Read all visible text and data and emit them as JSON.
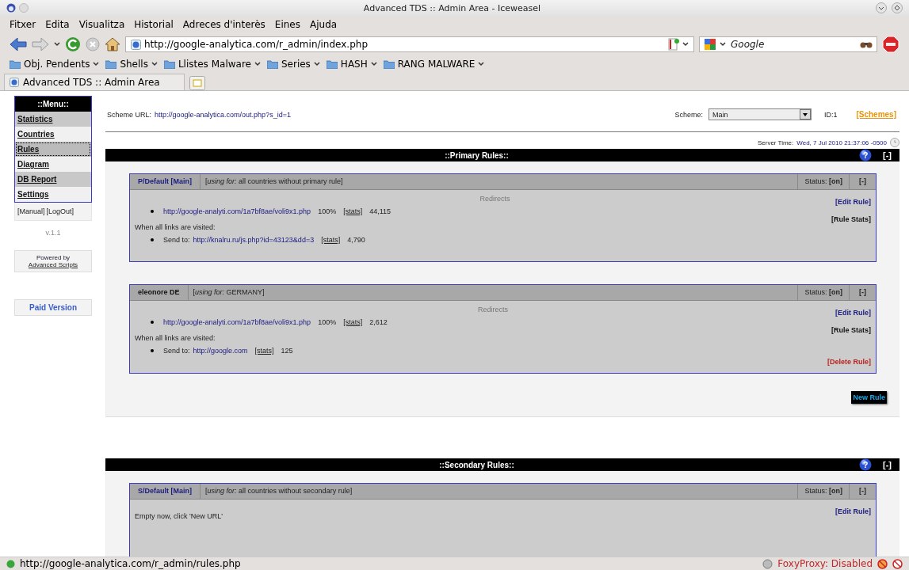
{
  "window": {
    "title": "Advanced TDS :: Admin Area - Iceweasel"
  },
  "menubar": [
    "Fitxer",
    "Edita",
    "Visualitza",
    "Historial",
    "Adreces d'interès",
    "Eines",
    "Ajuda"
  ],
  "address_bar": {
    "value": "http://google-analytica.com/r_admin/index.php"
  },
  "search_box": {
    "placeholder": "Google"
  },
  "bookmarks": [
    "Obj. Pendents",
    "Shells",
    "Llistes Malware",
    "Series",
    "HASH",
    "RANG MALWARE"
  ],
  "tabs": [
    {
      "label": "Advanced TDS :: Admin Area",
      "selected": true
    }
  ],
  "sidebar": {
    "title": "::Menu::",
    "items": [
      {
        "label": "Statistics",
        "selected": false
      },
      {
        "label": "Countries",
        "selected": false
      },
      {
        "label": "Rules",
        "selected": true
      },
      {
        "label": "Diagram",
        "selected": false
      },
      {
        "label": "DB Report",
        "selected": false
      },
      {
        "label": "Settings",
        "selected": false
      }
    ],
    "links": [
      "[Manual]",
      "[LogOut]"
    ],
    "version": "v.1.1",
    "powered_by": "Powered by",
    "powered_link": "Advanced Scripts",
    "paid": "Paid Version"
  },
  "header": {
    "scheme_url_label": "Scheme URL:",
    "scheme_url": "http://google-analytica.com/out.php?s_id=1",
    "scheme_label": "Scheme:",
    "scheme_value": "Main",
    "id": "ID:1",
    "schemes_link": "[Schemes]",
    "server_time_label": "Server Time:",
    "server_time": "Wed, 7 Jul 2010 21:37:06 -0500"
  },
  "sections": [
    {
      "title": "::Primary Rules::",
      "help": "?",
      "collapse": "[-]",
      "new_rule": "New Rule",
      "rules": [
        {
          "kind": "default",
          "name": "P/Default [Main]",
          "using": "[*using for:* all countries without primary rule]",
          "status": "Status: **[on]**",
          "collapse": "[-]",
          "redirects_label": "Redirects",
          "redirects": [
            {
              "url": "http://google-analyti.com/1a7bf8ae/voli9x1.php",
              "percent": "100%",
              "stats": "[stats]",
              "count": "44,115"
            }
          ],
          "visited_label": "When all links are visited:",
          "send_to": {
            "label": "Send to:",
            "url": "http://knalru.ru/js.php?id=43123&dd=3",
            "stats": "[stats]",
            "count": "4,790"
          },
          "actions": [
            {
              "kind": "edit",
              "label": "[Edit Rule]"
            },
            {
              "kind": "stats",
              "label": "[Rule Stats]"
            }
          ]
        },
        {
          "kind": "custom",
          "name": "eleonore DE",
          "using": "[*using for:* GERMANY]",
          "status": "Status: **[on]**",
          "collapse": "[-]",
          "redirects_label": "Redirects",
          "redirects": [
            {
              "url": "http://google-analyti.com/1a7bf8ae/voli9x1.php",
              "percent": "100%",
              "stats": "[stats]",
              "count": "2,612"
            }
          ],
          "visited_label": "When all links are visited:",
          "send_to": {
            "label": "Send to:",
            "url": "http://google.com",
            "stats": "[stats]",
            "count": "125"
          },
          "actions": [
            {
              "kind": "edit",
              "label": "[Edit Rule]"
            },
            {
              "kind": "stats",
              "label": "[Rule Stats]"
            },
            {
              "kind": "delete",
              "label": "[Delete Rule]"
            }
          ]
        }
      ]
    },
    {
      "title": "::Secondary Rules::",
      "help": "?",
      "collapse": "[-]",
      "rules": [
        {
          "kind": "default",
          "name": "S/Default [Main]",
          "using": "[*using for:* all countries without secondary rule]",
          "status": "Status: **[on]**",
          "collapse": "[-]",
          "empty_text": "Empty now, click 'New URL'",
          "actions": [
            {
              "kind": "edit",
              "label": "[Edit Rule]"
            }
          ]
        }
      ]
    }
  ],
  "status_bar": {
    "url": "http://google-analytica.com/r_admin/rules.php",
    "proxy": "FoxyProxy: Disabled"
  }
}
